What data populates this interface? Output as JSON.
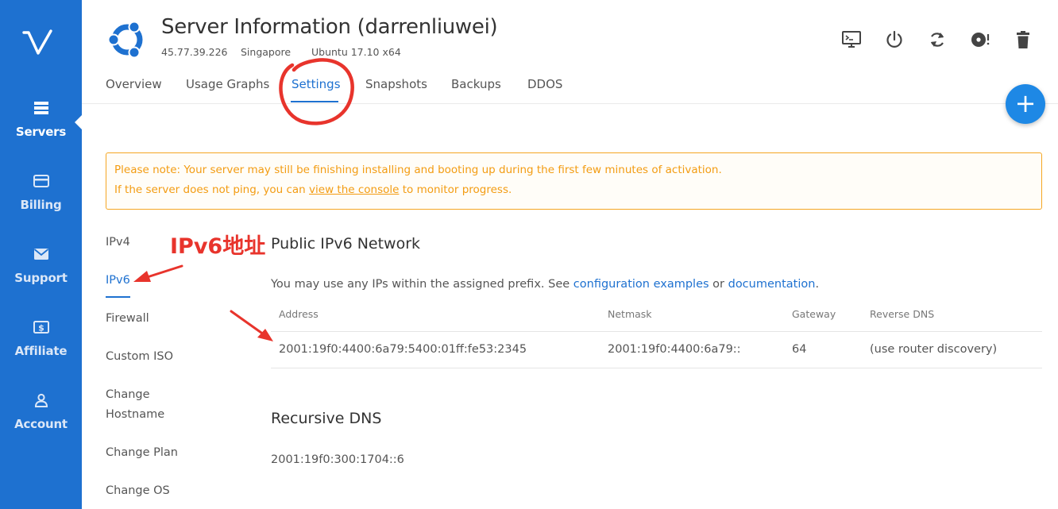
{
  "sidebar": {
    "items": [
      {
        "label": "Servers",
        "icon": "servers-icon",
        "active": true
      },
      {
        "label": "Billing",
        "icon": "credit-card-icon",
        "active": false
      },
      {
        "label": "Support",
        "icon": "envelope-icon",
        "active": false
      },
      {
        "label": "Affiliate",
        "icon": "dollar-icon",
        "active": false
      },
      {
        "label": "Account",
        "icon": "user-icon",
        "active": false
      }
    ]
  },
  "header": {
    "title": "Server Information (darrenliuwei)",
    "ip": "45.77.39.226",
    "location": "Singapore",
    "os": "Ubuntu 17.10 x64"
  },
  "toolbar": [
    "console-icon",
    "power-icon",
    "restart-icon",
    "reinstall-icon",
    "trash-icon"
  ],
  "tabs": [
    "Overview",
    "Usage Graphs",
    "Settings",
    "Snapshots",
    "Backups",
    "DDOS"
  ],
  "active_tab": "Settings",
  "notice": {
    "line1": "Please note: Your server may still be finishing installing and booting up during the first few minutes of activation.",
    "line2_prefix": "If the server does not ping, you can ",
    "line2_link": "view the console",
    "line2_suffix": " to monitor progress."
  },
  "settings_menu": [
    "IPv4",
    "IPv6",
    "Firewall",
    "Custom ISO",
    "Change",
    "Hostname",
    "Change Plan",
    "Change OS"
  ],
  "ipv6": {
    "title": "Public IPv6 Network",
    "desc_prefix": "You may use any IPs within the assigned prefix. See ",
    "desc_link1": "configuration examples",
    "desc_mid": " or ",
    "desc_link2": "documentation",
    "desc_suffix": ".",
    "columns": [
      "Address",
      "Netmask",
      "Gateway",
      "Reverse DNS"
    ],
    "rows": [
      {
        "address": "2001:19f0:4400:6a79:5400:01ff:fe53:2345",
        "netmask": "2001:19f0:4400:6a79::",
        "gateway": "64",
        "reverse_dns": "(use router discovery)"
      }
    ]
  },
  "dns": {
    "title": "Recursive DNS",
    "value": "2001:19f0:300:1704::6"
  },
  "annotation": {
    "label": "IPv6地址",
    "color": "#e8342c"
  },
  "colors": {
    "sidebar": "#1e71d0",
    "accent": "#1e71d0",
    "notice": "#f39c12",
    "fab": "#1e88e5"
  }
}
